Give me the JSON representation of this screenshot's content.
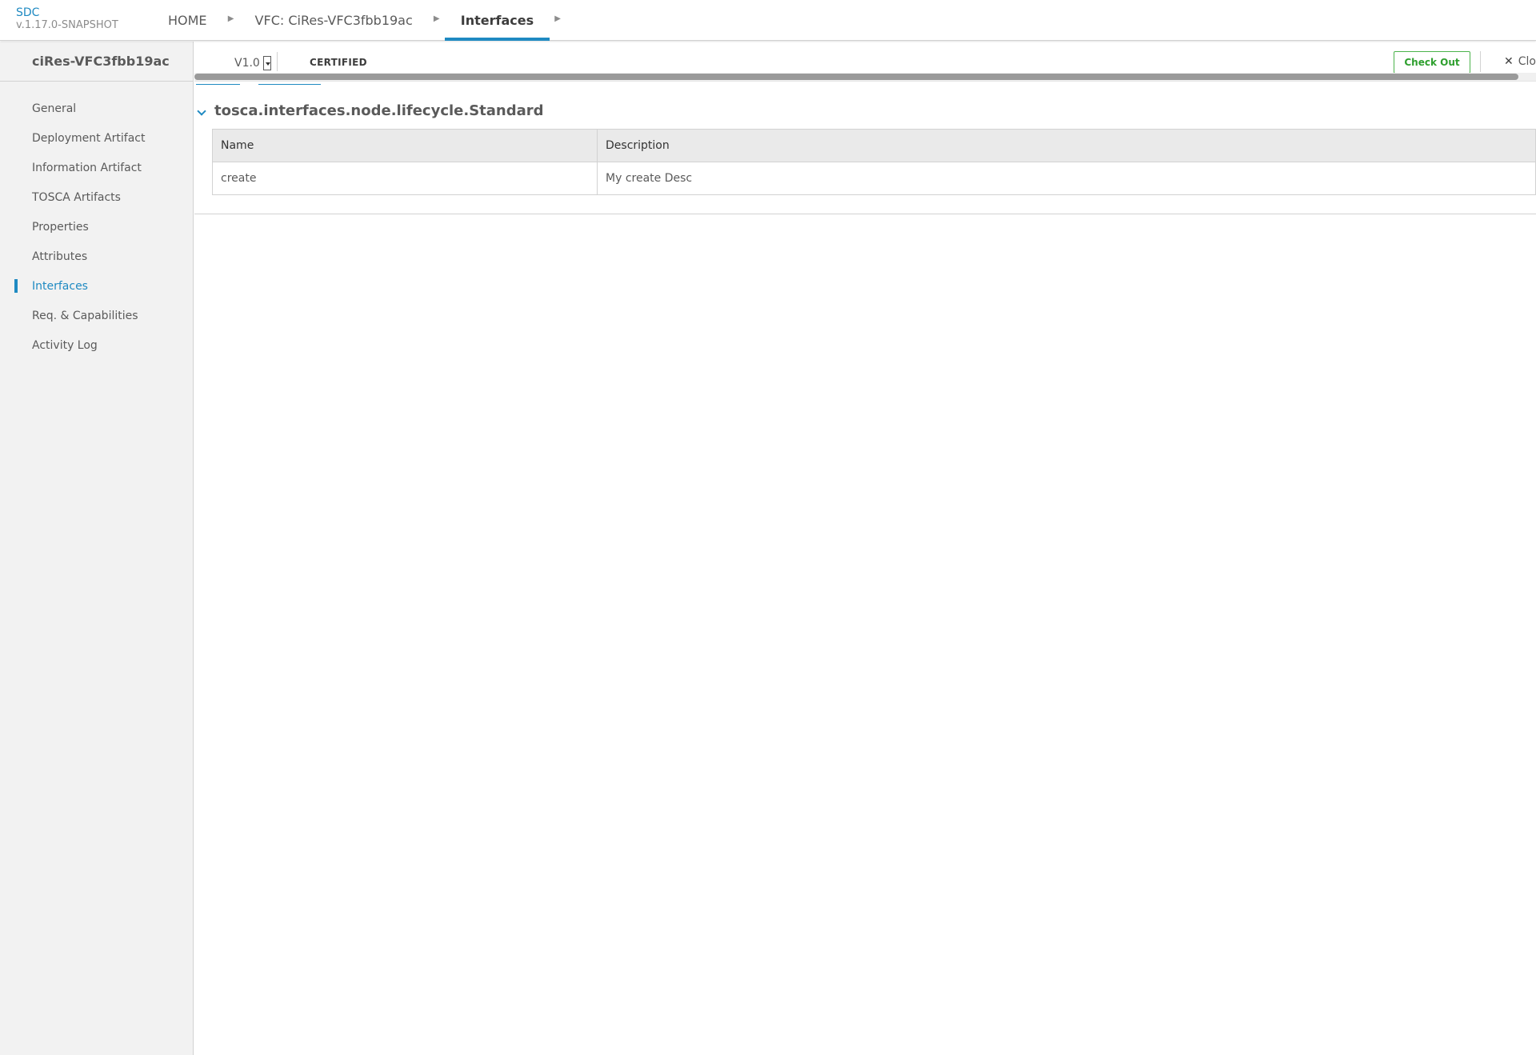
{
  "app": {
    "name": "SDC",
    "version": "v.1.17.0-SNAPSHOT"
  },
  "breadcrumb": [
    {
      "label": "HOME",
      "active": false
    },
    {
      "label": "VFC: CiRes-VFC3fbb19ac",
      "active": false
    },
    {
      "label": "Interfaces",
      "active": true
    }
  ],
  "sidebar": {
    "title": "ciRes-VFC3fbb19ac",
    "items": [
      {
        "label": "General"
      },
      {
        "label": "Deployment Artifact"
      },
      {
        "label": "Information Artifact"
      },
      {
        "label": "TOSCA Artifacts"
      },
      {
        "label": "Properties"
      },
      {
        "label": "Attributes"
      },
      {
        "label": "Interfaces",
        "selected": true
      },
      {
        "label": "Req. & Capabilities"
      },
      {
        "label": "Activity Log"
      }
    ]
  },
  "workspace_header": {
    "version": "V1.0",
    "status": "CERTIFIED",
    "checkout_label": "Check Out",
    "close_label": "Clo"
  },
  "interfaces": [
    {
      "name": "tosca.interfaces.node.lifecycle.Standard",
      "columns": [
        "Name",
        "Description"
      ],
      "operations": [
        {
          "name": "create",
          "description": "My create Desc"
        }
      ]
    }
  ],
  "colors": {
    "accent": "#1f8ac2",
    "checkout": "#4bb34b",
    "sidebar_bg": "#f2f2f2",
    "table_header_bg": "#eaeaea"
  }
}
